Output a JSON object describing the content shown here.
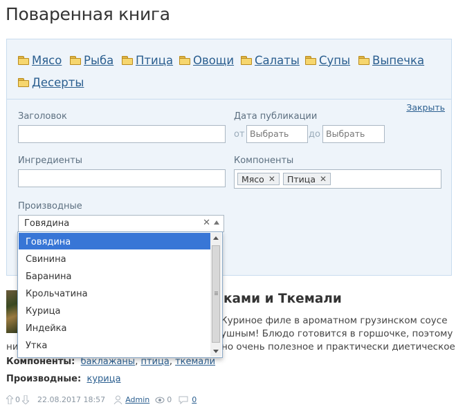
{
  "page": {
    "title": "Поваренная книга"
  },
  "categories": [
    "Мясо",
    "Рыба",
    "Птица",
    "Овощи",
    "Салаты",
    "Супы",
    "Выпечка",
    "Десерты"
  ],
  "filter": {
    "close_label": "Закрыть",
    "title_label": "Заголовок",
    "title_value": "",
    "date_label": "Дата публикации",
    "date_from_word": "от",
    "date_to_word": "до",
    "date_from_placeholder": "Выбрать",
    "date_to_placeholder": "Выбрать",
    "ingredients_label": "Ингредиенты",
    "ingredients_value": "",
    "components_label": "Компоненты",
    "components_tags": [
      "Мясо",
      "Птица"
    ],
    "derived_label": "Производные",
    "derived_selected": "Говядина",
    "derived_options": [
      "Говядина",
      "Свинина",
      "Баранина",
      "Крольчатина",
      "Курица",
      "Индейка",
      "Утка"
    ]
  },
  "article": {
    "title_visible": "ками и Ткемали",
    "desc_line1": "Куриное филе в ароматном грузинском соусе",
    "desc_line2": "ушным! Блюдо готовится в горшочке, поэтому",
    "desc_line3": "ни",
    "desc_line3b": "но очень полезное и практически диетическое.",
    "components_label": "Компоненты:",
    "components": [
      "баклажаны",
      "птица",
      "ткемали"
    ],
    "derived_label": "Производные:",
    "derived": [
      "курица"
    ],
    "votes_up": "0",
    "votes_down": "0",
    "date": "22.08.2017 18:57",
    "author": "Admin",
    "views": "0",
    "comments": "0"
  }
}
